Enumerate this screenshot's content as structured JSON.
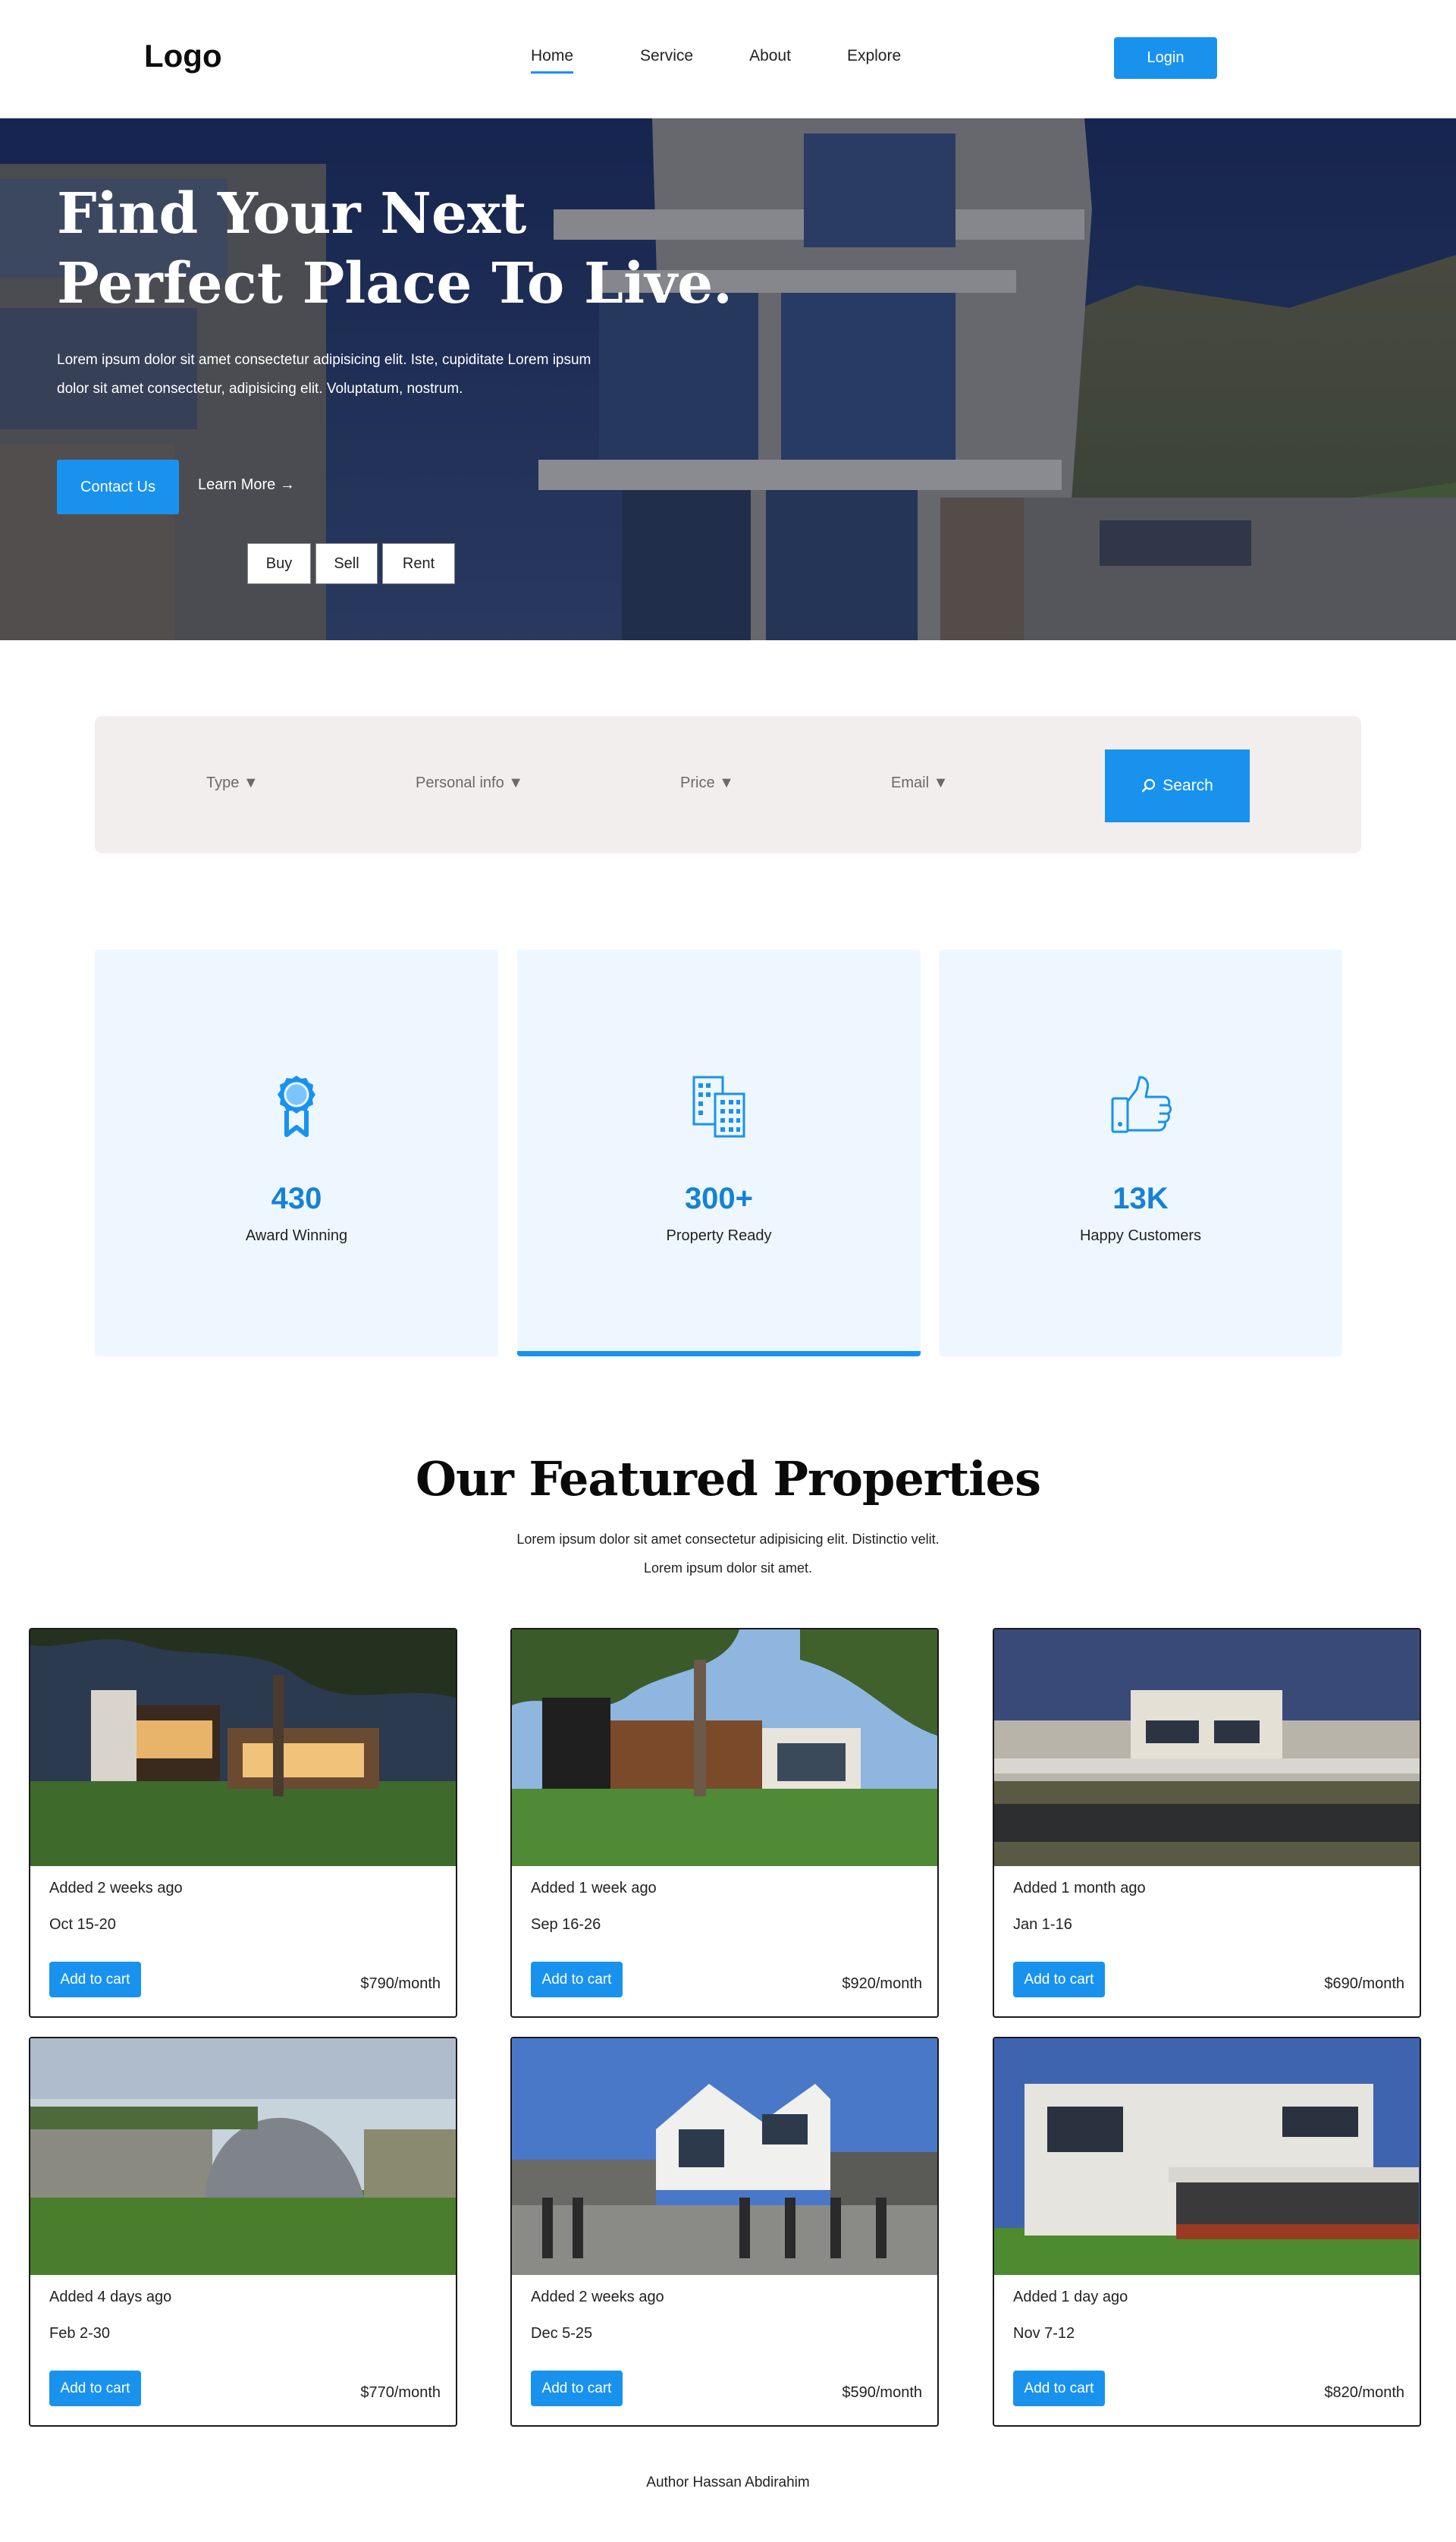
{
  "header": {
    "logo": "Logo",
    "nav": [
      "Home",
      "Service",
      "About",
      "Explore"
    ],
    "login_label": "Login"
  },
  "hero": {
    "title_line1": "Find Your Next",
    "title_line2": "Perfect Place To Live.",
    "description": "Lorem ipsum dolor sit amet consectetur adipisicing elit. Iste, cupiditate Lorem ipsum dolor sit amet consectetur, adipisicing elit. Voluptatum, nostrum.",
    "contact_label": "Contact Us",
    "learn_more_label": "Learn More →",
    "tabs": [
      "Buy",
      "Sell",
      "Rent"
    ]
  },
  "search": {
    "filters": [
      "Type ▼",
      "Personal info ▼",
      "Price ▼",
      "Email ▼"
    ],
    "button_label": "Search",
    "button_icon": "search-icon"
  },
  "stats": [
    {
      "icon": "award-ribbon-icon",
      "value": "430",
      "label": "Award Winning"
    },
    {
      "icon": "buildings-icon",
      "value": "300+",
      "label": "Property Ready"
    },
    {
      "icon": "thumbs-up-icon",
      "value": "13K",
      "label": "Happy Customers"
    }
  ],
  "featured": {
    "title": "Our Featured Properties",
    "desc_line1": "Lorem ipsum dolor sit amet consectetur adipisicing elit. Distinctio velit.",
    "desc_line2": "Lorem ipsum dolor sit amet."
  },
  "properties": [
    {
      "added": "Added 2 weeks ago",
      "dates": "Oct 15-20",
      "cart_label": "Add to cart",
      "price": "$790/month"
    },
    {
      "added": "Added 1 week ago",
      "dates": "Sep 16-26",
      "cart_label": "Add to cart",
      "price": "$920/month"
    },
    {
      "added": "Added 1 month ago",
      "dates": "Jan 1-16",
      "cart_label": "Add to cart",
      "price": "$690/month"
    },
    {
      "added": "Added 4 days ago",
      "dates": "Feb 2-30",
      "cart_label": "Add to cart",
      "price": "$770/month"
    },
    {
      "added": "Added 2 weeks ago",
      "dates": "Dec 5-25",
      "cart_label": "Add to cart",
      "price": "$590/month"
    },
    {
      "added": "Added 1 day ago",
      "dates": "Nov 7-12",
      "cart_label": "Add to cart",
      "price": "$820/month"
    }
  ],
  "footer": {
    "author": "Author Hassan Abdirahim"
  },
  "colors": {
    "accent": "#1992ee",
    "stat_value": "#1681d6",
    "stat_card_bg": "#eef7ff",
    "search_bg": "#f2eeed"
  }
}
